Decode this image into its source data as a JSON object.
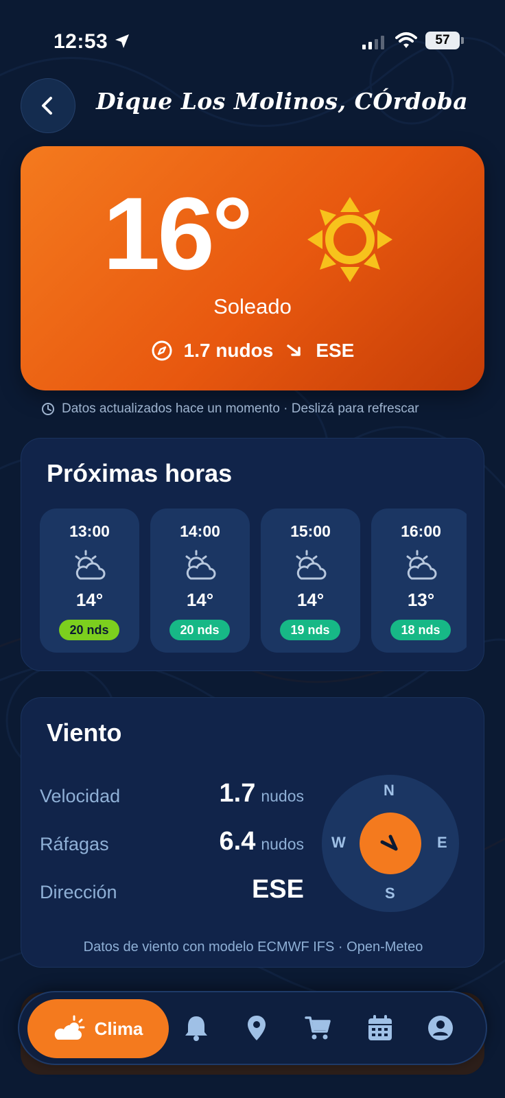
{
  "status_bar": {
    "time": "12:53",
    "battery": "57"
  },
  "header": {
    "title": "Dique Los Molinos, CÓrdoba"
  },
  "current": {
    "temperature": "16°",
    "condition": "Soleado",
    "wind_speed": "1.7 nudos",
    "wind_direction": "ESE",
    "icon": "sun-icon"
  },
  "updated_text": "Datos actualizados hace un momento · Deslizá para refrescar",
  "hourly": {
    "title": "Próximas horas",
    "items": [
      {
        "time": "13:00",
        "temp": "14°",
        "wind": "20 nds",
        "icon": "partly-cloudy-icon",
        "badge_color": "#7ccf1e"
      },
      {
        "time": "14:00",
        "temp": "14°",
        "wind": "20 nds",
        "icon": "partly-cloudy-icon",
        "badge_color": "#17b886"
      },
      {
        "time": "15:00",
        "temp": "14°",
        "wind": "19 nds",
        "icon": "partly-cloudy-icon",
        "badge_color": "#17b886"
      },
      {
        "time": "16:00",
        "temp": "13°",
        "wind": "18 nds",
        "icon": "partly-cloudy-icon",
        "badge_color": "#17b886"
      }
    ]
  },
  "wind": {
    "title": "Viento",
    "speed_label": "Velocidad",
    "speed_value": "1.7",
    "speed_unit": "nudos",
    "gust_label": "Ráfagas",
    "gust_value": "6.4",
    "gust_unit": "nudos",
    "direction_label": "Dirección",
    "direction_value": "ESE",
    "compass": {
      "n": "N",
      "e": "E",
      "s": "S",
      "w": "W"
    },
    "source": "Datos de viento con modelo ECMWF IFS · Open-Meteo"
  },
  "nav": {
    "active_label": "Clima",
    "items": [
      "weather-icon",
      "bell-icon",
      "location-pin-icon",
      "cart-icon",
      "calendar-icon",
      "profile-icon"
    ]
  },
  "colors": {
    "accent": "#f47a1e",
    "background": "#0b1a33",
    "card": "#11244a",
    "muted_text": "#8fb0d6"
  }
}
